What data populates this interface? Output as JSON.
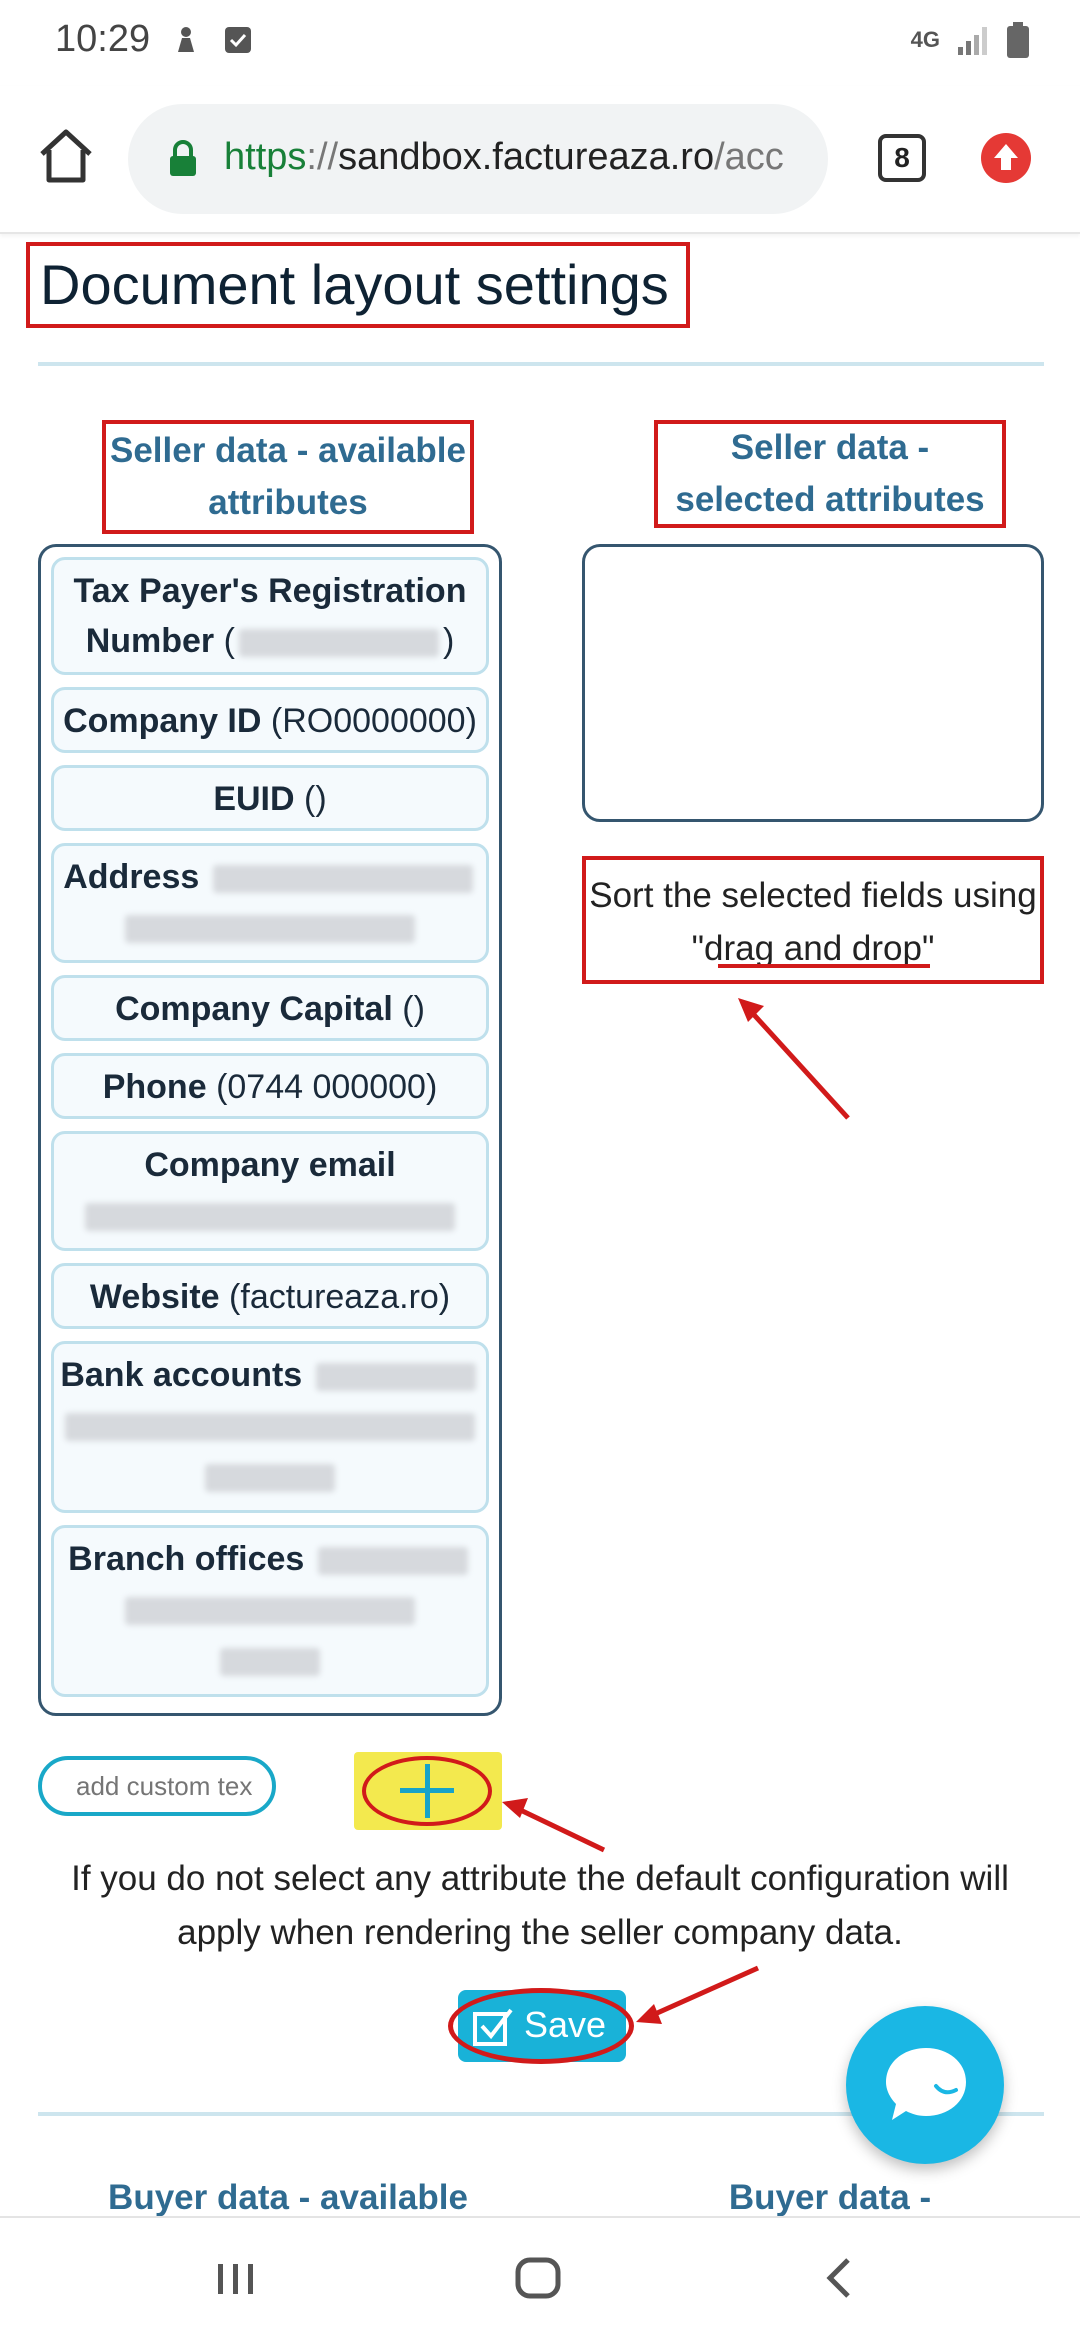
{
  "status_bar": {
    "time": "10:29",
    "left_icons": [
      "notification-icon",
      "checkbox-icon"
    ],
    "right_icons": [
      "4g-icon",
      "signal-icon",
      "battery-icon"
    ],
    "network": "4G"
  },
  "browser": {
    "url_scheme": "https",
    "url_separator": "://",
    "url_host": "sandbox.factureaza.ro",
    "url_path": "/acc",
    "tab_count": "8"
  },
  "page": {
    "title": "Document layout settings"
  },
  "seller": {
    "available_heading": "Seller data - available attributes",
    "selected_heading": "Seller data - selected attributes",
    "sort_hint_prefix": "Sort the selected fields using",
    "sort_hint_link": "\"drag and drop\"",
    "attributes": [
      {
        "name": "Tax Payer's Registration Number",
        "value": ""
      },
      {
        "name": "Company ID",
        "value": "(RO0000000)"
      },
      {
        "name": "EUID",
        "value": "()"
      },
      {
        "name": "Address",
        "value": ""
      },
      {
        "name": "Company Capital",
        "value": "()"
      },
      {
        "name": "Phone",
        "value": "(0744 000000)"
      },
      {
        "name": "Company email",
        "value": ""
      },
      {
        "name": "Website",
        "value": "(factureaza.ro)"
      },
      {
        "name": "Bank accounts",
        "value": ""
      },
      {
        "name": "Branch offices",
        "value": ""
      }
    ],
    "custom_text_placeholder": "add custom tex",
    "info": "If you do not select any attribute the default configuration will apply when rendering the seller company data.",
    "save_label": "Save"
  },
  "buyer": {
    "available_heading": "Buyer data - available",
    "selected_heading": "Buyer data - selected"
  },
  "colors": {
    "accent": "#19b2d8",
    "annotation_red": "#d11a1a",
    "heading_blue": "#2f6b91",
    "highlight_yellow": "#f3e94e"
  }
}
